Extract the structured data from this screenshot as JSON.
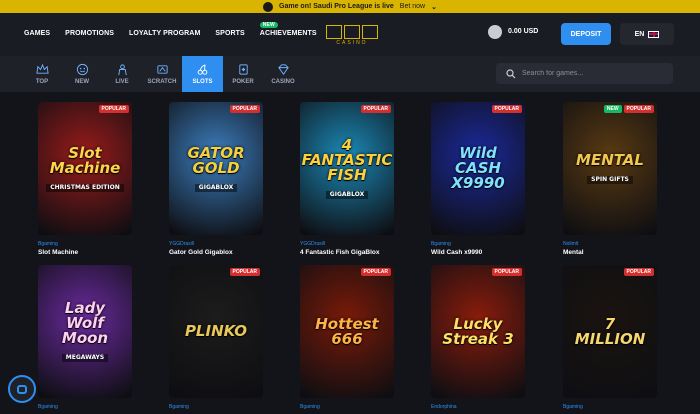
{
  "promo_bar": {
    "text": "Game on! Saudi Pro League is live",
    "link": "Bet now"
  },
  "nav": [
    "GAMES",
    "PROMOTIONS",
    "LOYALTY PROGRAM",
    "SPORTS",
    "ACHIEVEMENTS"
  ],
  "nav_new_badge": "NEW",
  "logo": {
    "sub": "CASINO"
  },
  "balance": "0.00 USD",
  "deposit_label": "DEPOSIT",
  "language": "EN",
  "categories": [
    {
      "label": "TOP",
      "icon": "crown-icon"
    },
    {
      "label": "NEW",
      "icon": "new-face-icon"
    },
    {
      "label": "LIVE",
      "icon": "dealer-icon"
    },
    {
      "label": "SCRATCH",
      "icon": "scratch-card-icon"
    },
    {
      "label": "SLOTS",
      "icon": "cherries-icon"
    },
    {
      "label": "POKER",
      "icon": "poker-chip-icon"
    },
    {
      "label": "CASINO",
      "icon": "diamond-icon"
    }
  ],
  "active_category": "SLOTS",
  "search": {
    "placeholder": "Search for games..."
  },
  "games": [
    {
      "provider": "Bgaming",
      "title": "Slot Machine",
      "badges": [
        "POPULAR"
      ],
      "art": "Slot Machine",
      "art_sub": "CHRISTMAS EDITION",
      "bg": "#9b1b1b"
    },
    {
      "provider": "YGGDrasill",
      "title": "Gator Gold Gigablox",
      "badges": [
        "POPULAR"
      ],
      "art": "GATOR GOLD",
      "art_sub": "GIGABLOX",
      "bg": "#3c7fc0"
    },
    {
      "provider": "YGGDrasill",
      "title": "4 Fantastic Fish GigaBlox",
      "badges": [
        "POPULAR"
      ],
      "art": "4 FANTASTIC FISH",
      "art_sub": "GIGABLOX",
      "bg": "#1b8ab8"
    },
    {
      "provider": "Bgaming",
      "title": "Wild Cash x9990",
      "badges": [
        "POPULAR"
      ],
      "art": "Wild CASH X9990",
      "art_sub": "",
      "bg": "#1b2a9c"
    },
    {
      "provider": "Nolimit",
      "title": "Mental",
      "badges": [
        "NEW",
        "POPULAR"
      ],
      "art": "MENTAL",
      "art_sub": "SPIN GIFTS",
      "bg": "#5a3a12"
    },
    {
      "provider": "Bgaming",
      "title": "",
      "badges": [],
      "art": "Lady Wolf Moon",
      "art_sub": "MEGAWAYS",
      "bg": "#6b2ba0"
    },
    {
      "provider": "Bgaming",
      "title": "",
      "badges": [
        "POPULAR"
      ],
      "art": "PLINKO",
      "art_sub": "",
      "bg": "#1c1c1c"
    },
    {
      "provider": "Bgaming",
      "title": "",
      "badges": [
        "POPULAR"
      ],
      "art": "Hottest 666",
      "art_sub": "",
      "bg": "#7a1a08"
    },
    {
      "provider": "Endorphina",
      "title": "",
      "badges": [
        "POPULAR"
      ],
      "art": "Lucky Streak 3",
      "art_sub": "",
      "bg": "#8a1c0c"
    },
    {
      "provider": "Bgaming",
      "title": "",
      "badges": [
        "POPULAR"
      ],
      "art": "7 MILLION",
      "art_sub": "",
      "bg": "#1a1410"
    }
  ]
}
